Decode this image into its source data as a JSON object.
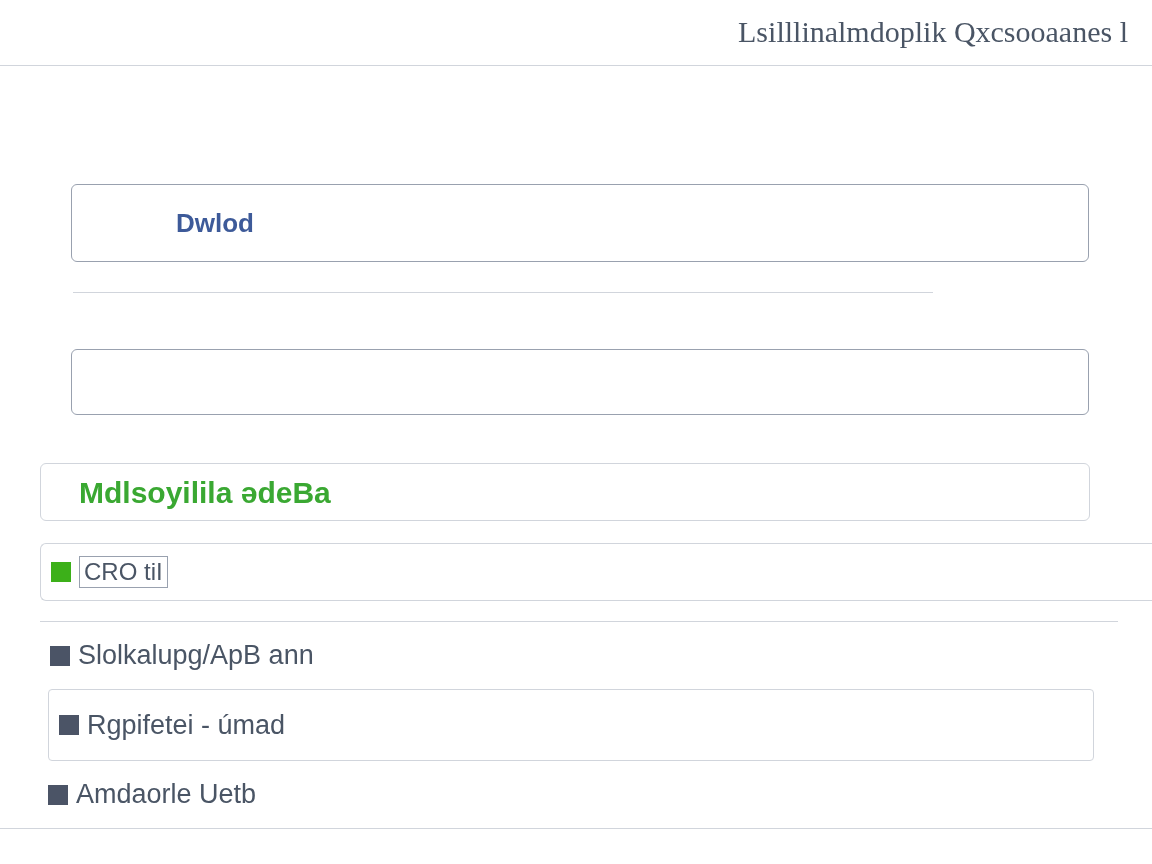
{
  "header": {
    "title": "Lsilllinalmdoplik Qxcsooaanes l"
  },
  "fields": [
    {
      "value": "Dwlod"
    }
  ],
  "banner": {
    "text": "Mdlsoyilila ədeBa"
  },
  "items": [
    {
      "kind": "boxed",
      "label": "CRO tiI",
      "color": "#3cb019"
    },
    {
      "kind": "plain",
      "label": "Slolkalupg/ApB ann",
      "color": "#4b5466"
    },
    {
      "kind": "plain",
      "label": "Rgpifetei - úmad",
      "color": "#4b5466"
    },
    {
      "kind": "plain",
      "label": "Amdaorle Uetb",
      "color": "#4b5466"
    }
  ]
}
